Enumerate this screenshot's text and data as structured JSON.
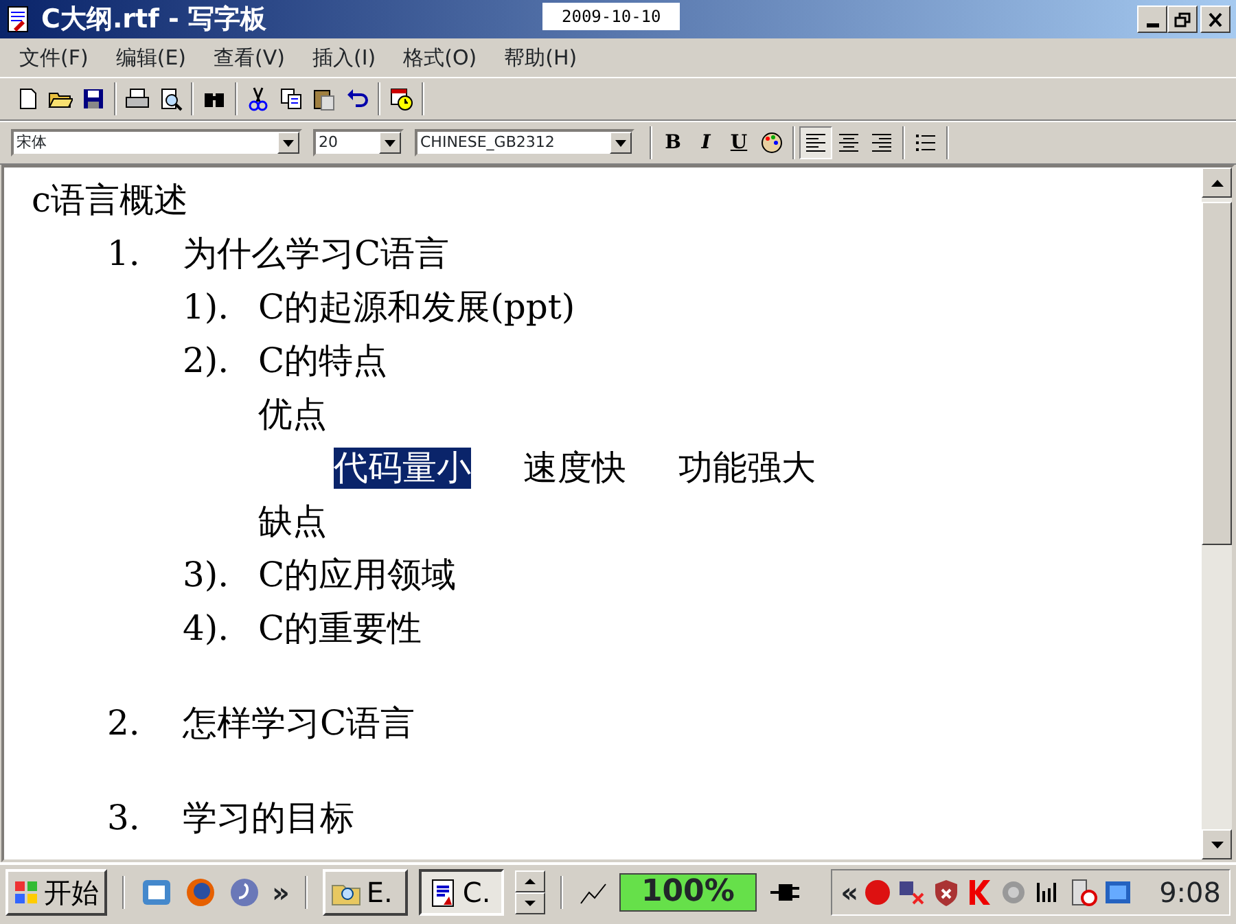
{
  "window": {
    "title": "C大纲.rtf - 写字板",
    "date": "2009-10-10"
  },
  "menu": [
    "文件(F)",
    "编辑(E)",
    "查看(V)",
    "插入(I)",
    "格式(O)",
    "帮助(H)"
  ],
  "format_bar": {
    "font": "宋体",
    "size": "20",
    "script": "CHINESE_GB2312",
    "buttons": [
      {
        "kind": "bold",
        "label": "B",
        "pressed": false
      },
      {
        "kind": "italic",
        "label": "I",
        "pressed": false
      },
      {
        "kind": "underline",
        "label": "U",
        "pressed": false
      },
      {
        "kind": "color",
        "pressed": false
      },
      {
        "kind": "align-left",
        "pressed": true
      },
      {
        "kind": "align-center",
        "pressed": false
      },
      {
        "kind": "align-right",
        "pressed": false
      },
      {
        "kind": "bullets",
        "pressed": false
      }
    ]
  },
  "document": [
    {
      "text": "c语言概述",
      "children": [
        {
          "number": "1.",
          "text": "为什么学习C语言",
          "children": [
            {
              "number": "1).",
              "text": "C的起源和发展(ppt)"
            },
            {
              "number": "2).",
              "text": "C的特点",
              "children": [
                {
                  "text": "优点",
                  "children": [
                    {
                      "kind": "words",
                      "words": [
                        {
                          "text": "代码量小",
                          "selected": true
                        },
                        {
                          "text": "速度快",
                          "selected": false
                        },
                        {
                          "text": "功能强大",
                          "selected": false
                        }
                      ]
                    }
                  ]
                },
                {
                  "text": "缺点"
                }
              ]
            },
            {
              "number": "3).",
              "text": "C的应用领域"
            },
            {
              "number": "4).",
              "text": "C的重要性"
            }
          ]
        },
        {
          "number": "2.",
          "text": "怎样学习C语言",
          "gap_before": true
        },
        {
          "number": "3.",
          "text": "学习的目标",
          "gap_before": true
        }
      ]
    }
  ],
  "taskbar": {
    "start": "开始",
    "more": "»",
    "tasks": [
      {
        "label": "E.",
        "selected": false
      },
      {
        "label": "C.",
        "selected": true
      }
    ],
    "battery": {
      "text": "100%",
      "level": 1
    },
    "tray_more": "«",
    "clock": "9:08"
  }
}
